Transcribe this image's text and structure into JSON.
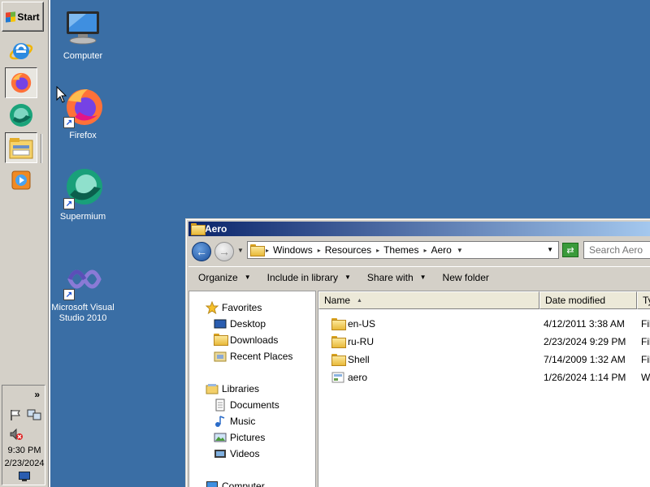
{
  "taskbar": {
    "start_label": "Start",
    "apps": [
      {
        "name": "internet-explorer"
      },
      {
        "name": "firefox"
      },
      {
        "name": "supermium"
      },
      {
        "name": "windows-explorer"
      },
      {
        "name": "media-player"
      }
    ],
    "tray": {
      "overflow": "»",
      "time": "9:30 PM",
      "date": "2/23/2024"
    }
  },
  "desktop": {
    "icons": [
      {
        "label": "Computer",
        "icon": "computer-icon"
      },
      {
        "label": "Firefox",
        "icon": "firefox-icon"
      },
      {
        "label": "Supermium",
        "icon": "supermium-icon"
      },
      {
        "label": "Microsoft Visual Studio 2010",
        "icon": "visual-studio-icon"
      }
    ]
  },
  "window": {
    "title": "Aero",
    "breadcrumbs": [
      "Windows",
      "Resources",
      "Themes",
      "Aero"
    ],
    "search_placeholder": "Search Aero",
    "toolbar": {
      "organize": "Organize",
      "include": "Include in library",
      "share": "Share with",
      "new_folder": "New folder"
    },
    "nav": {
      "favorites": "Favorites",
      "desktop": "Desktop",
      "downloads": "Downloads",
      "recent": "Recent Places",
      "libraries": "Libraries",
      "documents": "Documents",
      "music": "Music",
      "pictures": "Pictures",
      "videos": "Videos",
      "computer": "Computer"
    },
    "columns": {
      "name": "Name",
      "date": "Date modified",
      "type": "Typ"
    },
    "files": [
      {
        "name": "en-US",
        "date": "4/12/2011 3:38 AM",
        "type": "File",
        "kind": "folder"
      },
      {
        "name": "ru-RU",
        "date": "2/23/2024 9:29 PM",
        "type": "File",
        "kind": "folder"
      },
      {
        "name": "Shell",
        "date": "7/14/2009 1:32 AM",
        "type": "File",
        "kind": "folder"
      },
      {
        "name": "aero",
        "date": "1/26/2024 1:14 PM",
        "type": "Wi",
        "kind": "theme"
      }
    ]
  },
  "colors": {
    "desktop": "#3a6ea5",
    "taskbar": "#d4d0c8",
    "titlebar_start": "#0a246a",
    "titlebar_end": "#a6caf0"
  }
}
